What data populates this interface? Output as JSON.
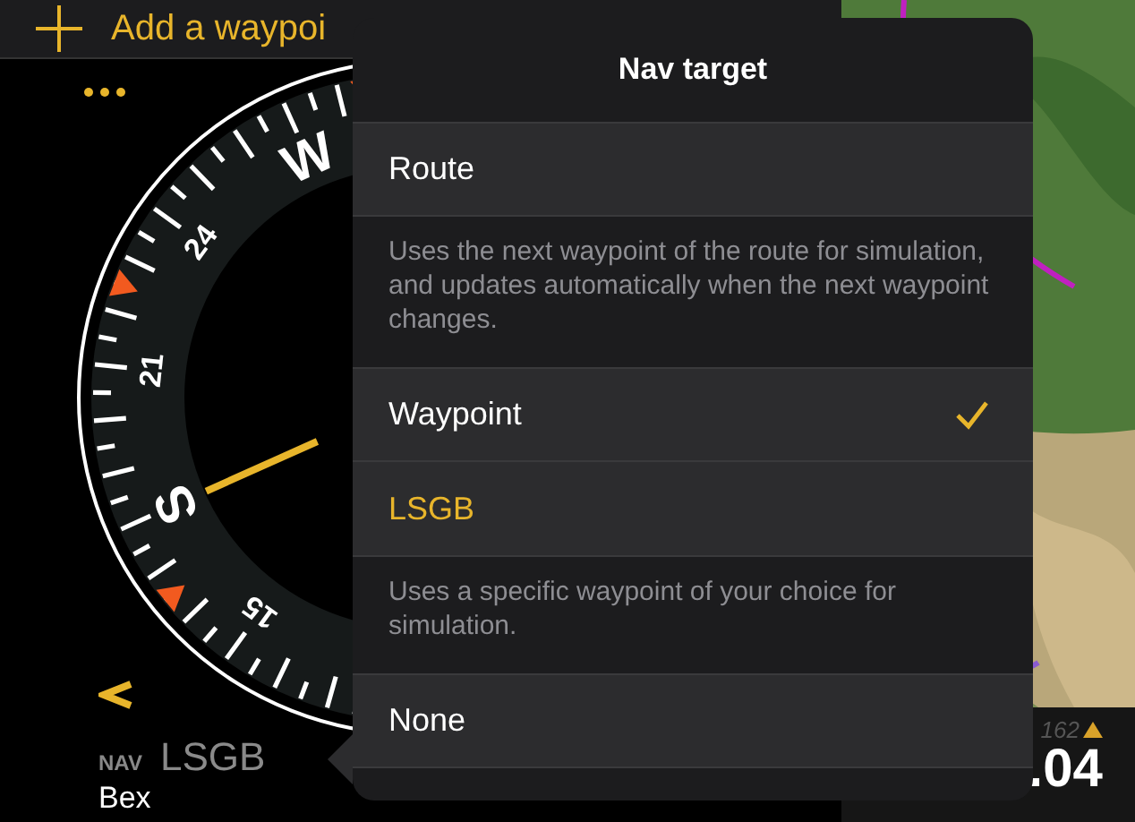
{
  "top_bar": {
    "add_label": "Add a waypoi"
  },
  "compass": {
    "labels": [
      "W",
      "24",
      "21",
      "S",
      "15"
    ]
  },
  "nav": {
    "label": "NAV",
    "code": "LSGB",
    "name": "Bex"
  },
  "readout": {
    "small": "162",
    "value": ".04"
  },
  "popover": {
    "title": "Nav target",
    "items": [
      {
        "kind": "option",
        "label": "Route",
        "selected": false
      },
      {
        "kind": "note",
        "text": "Uses the next waypoint of the route for simulation, and updates automatically when the next waypoint changes."
      },
      {
        "kind": "option",
        "label": "Waypoint",
        "selected": true
      },
      {
        "kind": "value",
        "label": "LSGB"
      },
      {
        "kind": "note",
        "text": "Uses a specific waypoint of your choice for simulation."
      },
      {
        "kind": "option",
        "label": "None",
        "selected": false
      }
    ]
  }
}
